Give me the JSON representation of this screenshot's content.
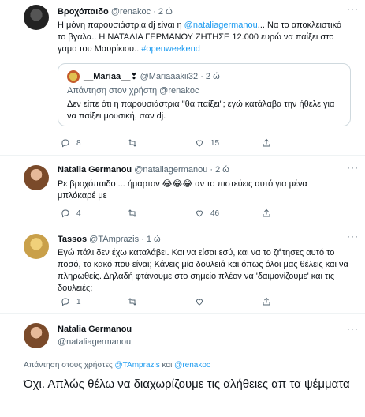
{
  "tweets": [
    {
      "name": "Βροχόπαιδο",
      "handle": "@renakoc",
      "time": "· 2 ώ",
      "text_parts": [
        "Η μόνη παρουσιάστρια dj είναι η ",
        "@nataliagermanou",
        "... Να το αποκλειστικό το βγαλα.. Η ΝΑΤΑΛΙΑ ΓΕΡΜΑΝΟΥ ΖΗΤΗΣΕ 12.000 ευρώ να παίξει στο γαμο του Μαυρίκιου.. ",
        "#openweekend"
      ],
      "quote": {
        "name": "__Mariaa__❣",
        "handle": "@Mariaaakii32",
        "time": "· 2 ώ",
        "reply_to": "Απάντηση στον χρήστη @renakoc",
        "text": "Δεν είπε ότι η παρουσιάστρια \"θα παίξει\"; εγώ κατάλαβα την ήθελε για να παίξει μουσική, σαν dj."
      },
      "actions": {
        "reply": "8",
        "retweet": "",
        "like": "15"
      }
    },
    {
      "name": "Natalia Germanou",
      "handle": "@nataliagermanou",
      "time": "· 2 ώ",
      "text_line1": "Ρε βροχόπαιδο ... ήμαρτον 😂😂😂 αν το πιστεύεις αυτό για μένα",
      "text_line2": "μπλόκαρέ με",
      "actions": {
        "reply": "4",
        "retweet": "",
        "like": "46"
      }
    },
    {
      "name": "Tassos",
      "handle": "@TAmprazis",
      "time": "· 1 ώ",
      "text": "Εγώ πάλι δεν έχω καταλάβει. Και να είσαι εσύ, και να το ζήτησες αυτό το ποσό, το κακό που είναι; Κάνεις μία δουλειά και όπως όλοι μας θέλεις και να πληρωθείς. Δηλαδή φτάνουμε στο σημείο πλέον να 'δαιμονίζουμε' και τις δουλειές;",
      "actions": {
        "reply": "1",
        "retweet": "",
        "like": ""
      }
    }
  ],
  "focus": {
    "name": "Natalia Germanou",
    "handle": "@nataliagermanou",
    "reply_prefix": "Απάντηση στους χρήστες ",
    "reply_user1": "@TAmprazis",
    "reply_and": " και ",
    "reply_user2": "@renakoc",
    "text": "Όχι. Απλώς θέλω να διαχωρίζουμε τις αλήθειες απ τα ψέμματα"
  },
  "icons": {
    "more": "more-dots-icon",
    "reply": "reply-icon",
    "retweet": "retweet-icon",
    "like": "heart-icon",
    "share": "share-icon"
  },
  "colors": {
    "link": "#1d9bf0",
    "secondary": "#536471",
    "border": "#cfd9de"
  }
}
